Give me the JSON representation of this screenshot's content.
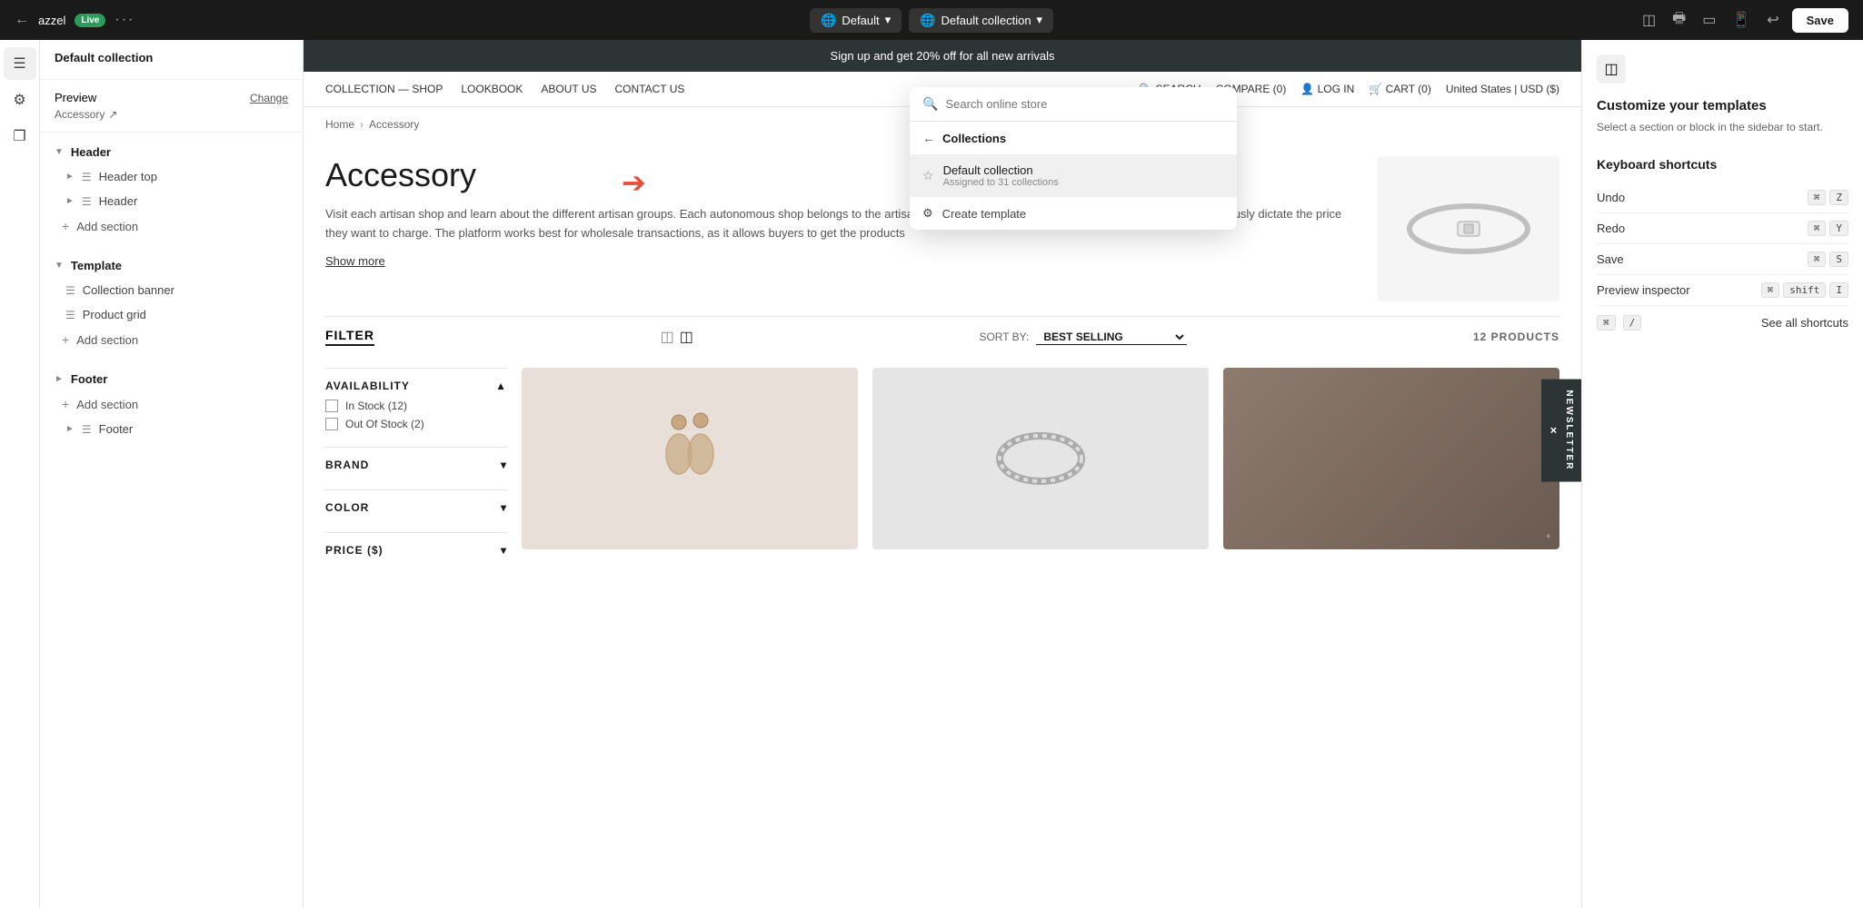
{
  "topbar": {
    "store_name": "azzel",
    "live_label": "Live",
    "more_icon": "···",
    "default_label": "Default",
    "collection_label": "Default collection",
    "undo_icon": "↩",
    "save_label": "Save"
  },
  "left_sidebar": {
    "section_title": "Default collection",
    "preview_label": "Preview",
    "preview_value": "Accessory",
    "change_label": "Change",
    "header_section": "Header",
    "header_top_label": "Header top",
    "header_label": "Header",
    "add_section_label_header": "Add section",
    "template_section": "Template",
    "collection_banner_label": "Collection banner",
    "product_grid_label": "Product grid",
    "add_section_label_template": "Add section",
    "footer_section": "Footer",
    "add_section_label_footer": "Add section",
    "footer_label": "Footer"
  },
  "store_preview": {
    "announcement": "Sign up and get 20% off for all new arrivals",
    "nav_links": [
      "COLLECTION",
      "SHOP",
      "LOOKBOOK",
      "ABOUT US",
      "CONTACT US"
    ],
    "nav_right": [
      "SEARCH",
      "COMPARE (0)",
      "LOG IN",
      "CART (0)"
    ],
    "location": "United States | USD ($)",
    "breadcrumb_home": "Home",
    "breadcrumb_page": "Accessory",
    "collection_title": "Accessory",
    "collection_desc": "Visit each artisan shop and learn about the different artisan groups. Each autonomous shop belongs to the artisan communities where they manage the inventory and consciously dictate the price they want to charge. The platform works best for wholesale transactions, as it allows buyers to get the products",
    "show_more": "Show more",
    "filter_title": "FILTER",
    "sort_by_label": "SORT BY:",
    "sort_value": "BEST SELLING",
    "products_count": "12 PRODUCTS",
    "availability_label": "AVAILABILITY",
    "in_stock_label": "In Stock (12)",
    "out_of_stock_label": "Out Of Stock (2)",
    "brand_label": "BRAND",
    "color_label": "COLOR",
    "price_label": "PRICE ($)",
    "newsletter_label": "NEWSLETTER"
  },
  "dropdown": {
    "search_placeholder": "Search online store",
    "back_label": "Collections",
    "default_collection_title": "Default collection",
    "default_collection_sub": "Assigned to 31 collections",
    "create_template_label": "Create template"
  },
  "right_panel": {
    "title": "Customize your templates",
    "subtitle": "Select a section or block in the sidebar to start.",
    "shortcuts_title": "Keyboard shortcuts",
    "shortcuts": [
      {
        "name": "Undo",
        "key": "Z"
      },
      {
        "name": "Redo",
        "key": "Y"
      },
      {
        "name": "Save",
        "key": "S"
      },
      {
        "name": "Preview inspector",
        "key": "I",
        "modifier": "shift"
      },
      {
        "name": "See all shortcuts",
        "key": "/"
      }
    ]
  }
}
